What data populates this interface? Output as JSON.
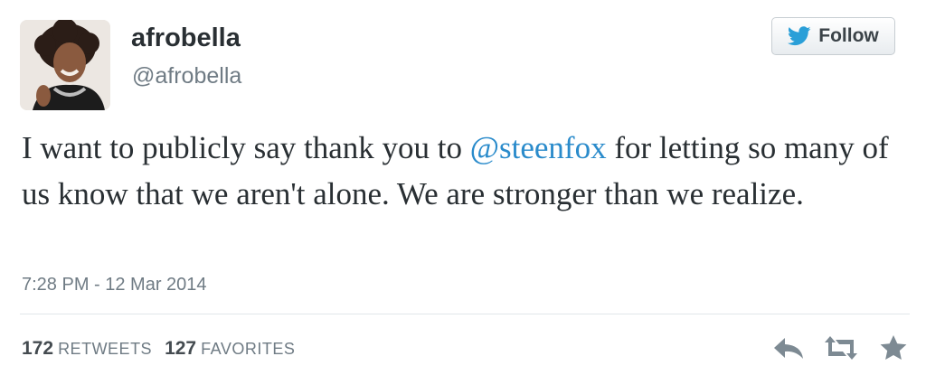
{
  "user": {
    "display_name": "afrobella",
    "screen_name": "@afrobella"
  },
  "follow_button": {
    "label": "Follow",
    "icon": "twitter-bird-icon"
  },
  "tweet": {
    "text_before": "I want to publicly say thank you to ",
    "mention": "@steenfox",
    "text_after": " for letting so many of us know that we aren't alone. We are stronger than we realize.",
    "timestamp": "7:28 PM - 12 Mar 2014"
  },
  "stats": {
    "retweets_count": "172",
    "retweets_label": "RETWEETS",
    "favorites_count": "127",
    "favorites_label": "FAVORITES"
  },
  "actions": [
    "reply-icon",
    "retweet-icon",
    "favorite-star-icon"
  ],
  "colors": {
    "link": "#2a8bcb",
    "meta_text": "#6f7b84",
    "action_icon": "#7d8a93"
  }
}
